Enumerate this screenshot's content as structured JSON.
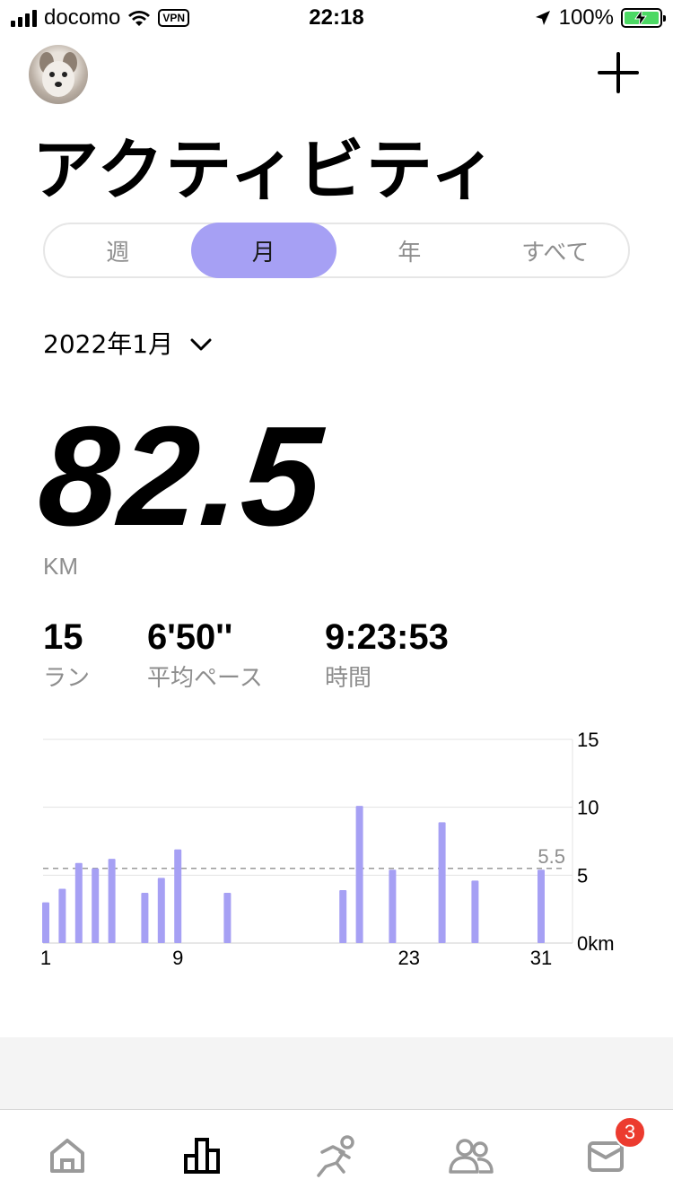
{
  "status_bar": {
    "carrier": "docomo",
    "vpn": "VPN",
    "time": "22:18",
    "battery": "100%"
  },
  "header": {
    "title": "アクティビティ"
  },
  "segments": [
    {
      "label": "週",
      "active": false
    },
    {
      "label": "月",
      "active": true
    },
    {
      "label": "年",
      "active": false
    },
    {
      "label": "すべて",
      "active": false
    }
  ],
  "period": {
    "label": "2022年1月"
  },
  "summary": {
    "distance": "82.5",
    "unit": "KM",
    "stats": [
      {
        "value": "15",
        "label": "ラン"
      },
      {
        "value": "6'50''",
        "label": "平均ペース"
      },
      {
        "value": "9:23:53",
        "label": "時間"
      }
    ]
  },
  "chart_data": {
    "type": "bar",
    "x": [
      1,
      2,
      3,
      4,
      5,
      7,
      8,
      9,
      12,
      19,
      20,
      22,
      25,
      27,
      31
    ],
    "values": [
      3.0,
      4.0,
      5.9,
      5.5,
      6.2,
      3.7,
      4.8,
      6.9,
      3.7,
      3.9,
      10.1,
      5.4,
      8.9,
      4.6,
      5.4
    ],
    "x_tick_labels": [
      "1",
      "9",
      "23",
      "31"
    ],
    "x_tick_values": [
      1,
      9,
      23,
      31
    ],
    "y_tick_labels": [
      "15",
      "10",
      "5",
      "0km"
    ],
    "y_tick_values": [
      15,
      10,
      5,
      0
    ],
    "ylim": [
      0,
      15
    ],
    "xlim": [
      1,
      31
    ],
    "average": 5.5,
    "average_label": "5.5",
    "bar_color": "#a6a0f4",
    "grid": true
  },
  "tabbar": {
    "items": [
      "home-icon",
      "activity-icon",
      "run-icon",
      "community-icon",
      "inbox-icon"
    ],
    "active": "activity-icon",
    "badge": "3"
  },
  "colors": {
    "accent": "#a6a0f4",
    "badge": "#ec3b2f",
    "muted": "#8e8e8e"
  }
}
